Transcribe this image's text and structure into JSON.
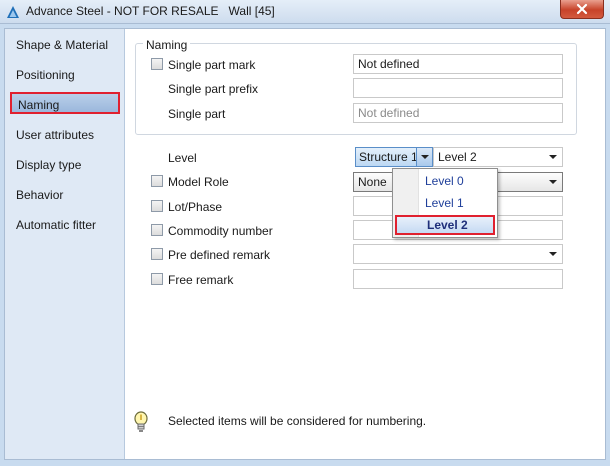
{
  "window": {
    "title": "Advance Steel - NOT FOR RESALE   Wall [45]"
  },
  "sidebar": {
    "items": [
      {
        "label": "Shape & Material"
      },
      {
        "label": "Positioning"
      },
      {
        "label": "Naming",
        "active": true
      },
      {
        "label": "User attributes"
      },
      {
        "label": "Display type"
      },
      {
        "label": "Behavior"
      },
      {
        "label": "Automatic fitter"
      }
    ]
  },
  "naming_group": {
    "title": "Naming",
    "single_part_mark": {
      "label": "Single part mark",
      "value": "Not defined",
      "checked": false
    },
    "single_part_prefix": {
      "label": "Single part prefix",
      "value": ""
    },
    "single_part": {
      "label": "Single part",
      "value": "Not defined"
    }
  },
  "level": {
    "label": "Level",
    "structure_value": "Structure 1",
    "level_value": "Level 2",
    "dropdown_options": [
      "Level 0",
      "Level 1",
      "Level 2"
    ],
    "selected_option": "Level 2"
  },
  "fields": {
    "model_role": {
      "label": "Model Role",
      "value": "None",
      "checked": false
    },
    "lot_phase": {
      "label": "Lot/Phase",
      "value": "",
      "checked": false
    },
    "commodity_number": {
      "label": "Commodity number",
      "value": "",
      "checked": false
    },
    "pre_defined_remark": {
      "label": "Pre defined remark",
      "value": "",
      "checked": false
    },
    "free_remark": {
      "label": "Free remark",
      "value": "",
      "checked": false
    }
  },
  "hint": {
    "text": "Selected items will be considered for numbering.",
    "icon": "lightbulb-icon"
  },
  "colors": {
    "highlight_border": "#e0202f",
    "sidebar_bg": "#dfe9f5",
    "title_bg": "#cddcee",
    "close_button": "#c7432a"
  }
}
